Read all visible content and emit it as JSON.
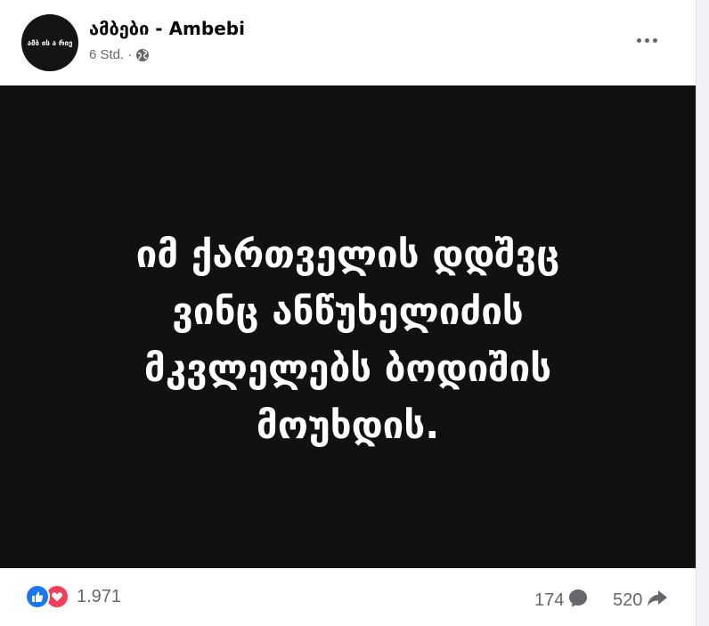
{
  "post": {
    "page_name": "ამბები - Ambebi",
    "avatar_text": "ამბ ის ა რიე",
    "time": "6 Std.",
    "separator": "·",
    "privacy_icon": "globe-icon",
    "more_icon": "more-horizontal-icon",
    "image_text_lines": [
      "იმ ქართველის დდშვც",
      "ვინც ანწუხელიძის",
      "მკვლელებს ბოდიშის",
      "მოუხდის."
    ]
  },
  "footer": {
    "reactions": [
      "like-icon",
      "love-icon"
    ],
    "reaction_count": "1.971",
    "comment_count": "174",
    "comment_icon": "comment-bubble-icon",
    "share_count": "520",
    "share_icon": "share-arrow-icon"
  },
  "colors": {
    "image_background": "#111111",
    "like": "#1877f2",
    "love": "#f33e58",
    "muted_text": "#65676b"
  }
}
